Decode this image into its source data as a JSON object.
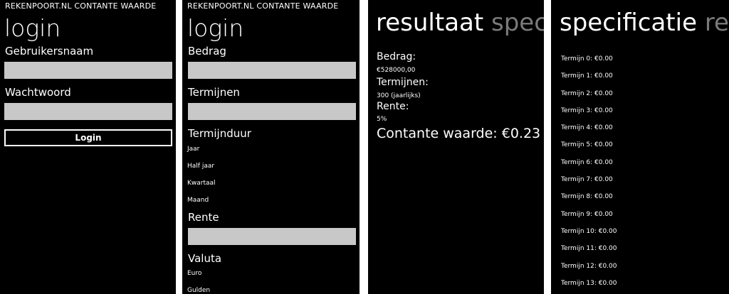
{
  "app": {
    "title": "REKENPOORT.NL CONTANTE WAARDE"
  },
  "login_screen": {
    "title": "login",
    "username_label": "Gebruikersnaam",
    "username_value": "",
    "password_label": "Wachtwoord",
    "password_value": "",
    "login_button": "Login"
  },
  "input_screen": {
    "title": "login",
    "amount_label": "Bedrag",
    "amount_value": "",
    "terms_label": "Termijnen",
    "terms_value": "",
    "duration_label": "Termijnduur",
    "duration_options": [
      "Jaar",
      "Half jaar",
      "Kwartaal",
      "Maand"
    ],
    "rate_label": "Rente",
    "rate_value": "",
    "currency_label": "Valuta",
    "currency_options": [
      "Euro",
      "Gulden"
    ]
  },
  "result_screen": {
    "pivot_active": "resultaat",
    "pivot_next": "specif",
    "amount_label": "Bedrag:",
    "amount_value": "€528000,00",
    "terms_label": "Termijnen:",
    "terms_value": "300 (jaarlijks)",
    "rate_label": "Rente:",
    "rate_value": "5%",
    "present_value": "Contante waarde: €0.23"
  },
  "spec_screen": {
    "pivot_active": "specificatie",
    "pivot_next": "resu",
    "items": [
      "Termijn 0: €0.00",
      "Termijn 1: €0.00",
      "Termijn 2: €0.00",
      "Termijn 3: €0.00",
      "Termijn 4: €0.00",
      "Termijn 5: €0.00",
      "Termijn 6: €0.00",
      "Termijn 7: €0.00",
      "Termijn 8: €0.00",
      "Termijn 9: €0.00",
      "Termijn 10: €0.00",
      "Termijn 11: €0.00",
      "Termijn 12: €0.00",
      "Termijn 13: €0.00"
    ]
  },
  "colors": {
    "background": "#000000",
    "text": "#ffffff",
    "field": "#c8c8c8",
    "pivot_inactive": "#7a7a7a",
    "separator": "#ffffff"
  }
}
